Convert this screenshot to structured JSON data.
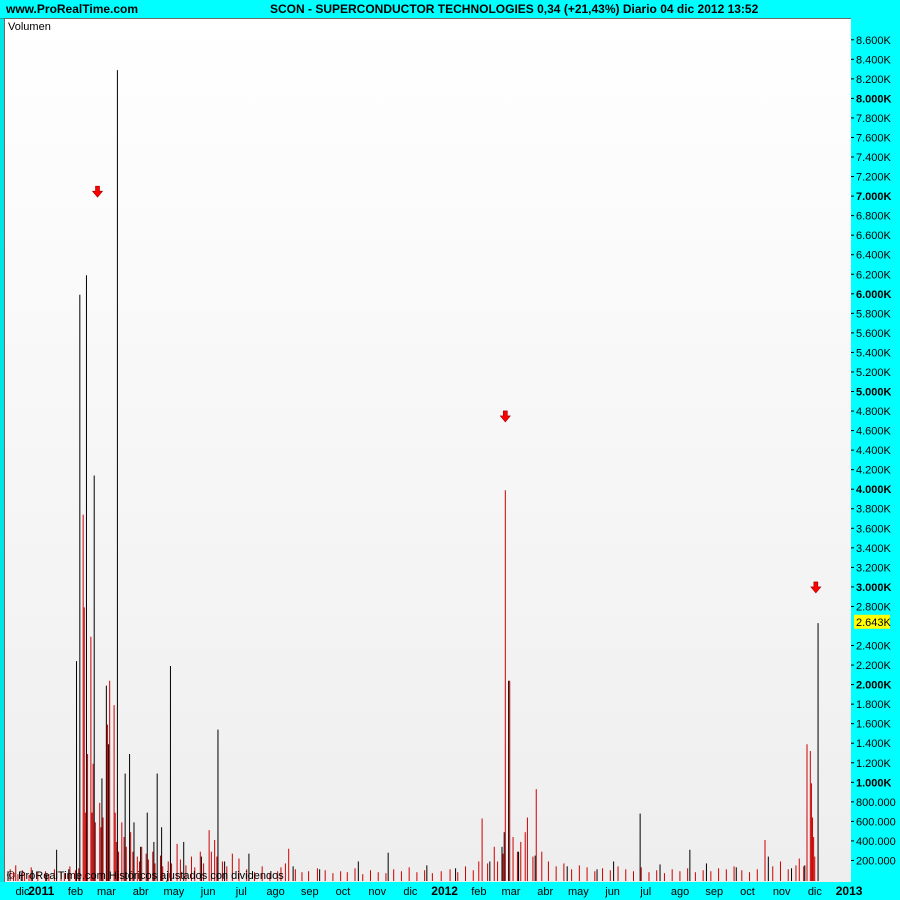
{
  "header": {
    "site": "www.ProRealTime.com",
    "title": "SCON - SUPERCONDUCTOR TECHNOLOGIES    0,34 (+21,43%)   Diario  04 dic 2012 13:52"
  },
  "plot": {
    "label": "Volumen",
    "footnote": "© ProRealTime.com  Históricos ajustados con dividendos"
  },
  "colors": {
    "up_bar": "#000000",
    "down_bar": "#cc0000",
    "marker": "#ff0000",
    "last_value_bg": "#ffff00",
    "axis_bg": "#00ffff"
  },
  "chart_data": {
    "type": "bar",
    "title": "SCON - SUPERCONDUCTOR TECHNOLOGIES",
    "indicator": "Volumen",
    "last_value_label": "2.643K",
    "last_value": 2643000,
    "ylim": [
      0,
      8700000
    ],
    "y_ticks": [
      {
        "v": 200000,
        "label": "200.000",
        "bold": false
      },
      {
        "v": 400000,
        "label": "400.000",
        "bold": false
      },
      {
        "v": 600000,
        "label": "600.000",
        "bold": false
      },
      {
        "v": 800000,
        "label": "800.000",
        "bold": false
      },
      {
        "v": 1000000,
        "label": "1.000K",
        "bold": true
      },
      {
        "v": 1200000,
        "label": "1.200K",
        "bold": false
      },
      {
        "v": 1400000,
        "label": "1.400K",
        "bold": false
      },
      {
        "v": 1600000,
        "label": "1.600K",
        "bold": false
      },
      {
        "v": 1800000,
        "label": "1.800K",
        "bold": false
      },
      {
        "v": 2000000,
        "label": "2.000K",
        "bold": true
      },
      {
        "v": 2200000,
        "label": "2.200K",
        "bold": false
      },
      {
        "v": 2400000,
        "label": "2.400K",
        "bold": false
      },
      {
        "v": 2800000,
        "label": "2.800K",
        "bold": false
      },
      {
        "v": 3000000,
        "label": "3.000K",
        "bold": true
      },
      {
        "v": 3200000,
        "label": "3.200K",
        "bold": false
      },
      {
        "v": 3400000,
        "label": "3.400K",
        "bold": false
      },
      {
        "v": 3600000,
        "label": "3.600K",
        "bold": false
      },
      {
        "v": 3800000,
        "label": "3.800K",
        "bold": false
      },
      {
        "v": 4000000,
        "label": "4.000K",
        "bold": true
      },
      {
        "v": 4200000,
        "label": "4.200K",
        "bold": false
      },
      {
        "v": 4400000,
        "label": "4.400K",
        "bold": false
      },
      {
        "v": 4600000,
        "label": "4.600K",
        "bold": false
      },
      {
        "v": 4800000,
        "label": "4.800K",
        "bold": false
      },
      {
        "v": 5000000,
        "label": "5.000K",
        "bold": true
      },
      {
        "v": 5200000,
        "label": "5.200K",
        "bold": false
      },
      {
        "v": 5400000,
        "label": "5.400K",
        "bold": false
      },
      {
        "v": 5600000,
        "label": "5.600K",
        "bold": false
      },
      {
        "v": 5800000,
        "label": "5.800K",
        "bold": false
      },
      {
        "v": 6000000,
        "label": "6.000K",
        "bold": true
      },
      {
        "v": 6200000,
        "label": "6.200K",
        "bold": false
      },
      {
        "v": 6400000,
        "label": "6.400K",
        "bold": false
      },
      {
        "v": 6600000,
        "label": "6.600K",
        "bold": false
      },
      {
        "v": 6800000,
        "label": "6.800K",
        "bold": false
      },
      {
        "v": 7000000,
        "label": "7.000K",
        "bold": true
      },
      {
        "v": 7200000,
        "label": "7.200K",
        "bold": false
      },
      {
        "v": 7400000,
        "label": "7.400K",
        "bold": false
      },
      {
        "v": 7600000,
        "label": "7.600K",
        "bold": false
      },
      {
        "v": 7800000,
        "label": "7.800K",
        "bold": false
      },
      {
        "v": 8000000,
        "label": "8.000K",
        "bold": true
      },
      {
        "v": 8200000,
        "label": "8.200K",
        "bold": false
      },
      {
        "v": 8400000,
        "label": "8.400K",
        "bold": false
      },
      {
        "v": 8600000,
        "label": "8.600K",
        "bold": false
      }
    ],
    "xlim": [
      "2010-12-01",
      "2012-12-31"
    ],
    "x_ticks": [
      {
        "date": "2010-12-15",
        "label": "dic",
        "bold": false
      },
      {
        "date": "2011-01-01",
        "label": "2011",
        "bold": true
      },
      {
        "date": "2011-02-01",
        "label": "feb",
        "bold": false
      },
      {
        "date": "2011-03-01",
        "label": "mar",
        "bold": false
      },
      {
        "date": "2011-04-01",
        "label": "abr",
        "bold": false
      },
      {
        "date": "2011-05-01",
        "label": "may",
        "bold": false
      },
      {
        "date": "2011-06-01",
        "label": "jun",
        "bold": false
      },
      {
        "date": "2011-07-01",
        "label": "jul",
        "bold": false
      },
      {
        "date": "2011-08-01",
        "label": "ago",
        "bold": false
      },
      {
        "date": "2011-09-01",
        "label": "sep",
        "bold": false
      },
      {
        "date": "2011-10-01",
        "label": "oct",
        "bold": false
      },
      {
        "date": "2011-11-01",
        "label": "nov",
        "bold": false
      },
      {
        "date": "2011-12-01",
        "label": "dic",
        "bold": false
      },
      {
        "date": "2012-01-01",
        "label": "2012",
        "bold": true
      },
      {
        "date": "2012-02-01",
        "label": "feb",
        "bold": false
      },
      {
        "date": "2012-03-01",
        "label": "mar",
        "bold": false
      },
      {
        "date": "2012-04-01",
        "label": "abr",
        "bold": false
      },
      {
        "date": "2012-05-01",
        "label": "may",
        "bold": false
      },
      {
        "date": "2012-06-01",
        "label": "jun",
        "bold": false
      },
      {
        "date": "2012-07-01",
        "label": "jul",
        "bold": false
      },
      {
        "date": "2012-08-01",
        "label": "ago",
        "bold": false
      },
      {
        "date": "2012-09-01",
        "label": "sep",
        "bold": false
      },
      {
        "date": "2012-10-01",
        "label": "oct",
        "bold": false
      },
      {
        "date": "2012-11-01",
        "label": "nov",
        "bold": false
      },
      {
        "date": "2012-12-01",
        "label": "dic",
        "bold": false
      },
      {
        "date": "2013-01-01",
        "label": "2013",
        "bold": true
      }
    ],
    "markers": [
      {
        "date": "2011-02-20",
        "v": 7050000
      },
      {
        "date": "2012-02-24",
        "v": 4750000
      },
      {
        "date": "2012-12-01",
        "v": 3000000
      }
    ],
    "series": [
      {
        "color": "down",
        "x": [
          "2010-12-03",
          "2010-12-06",
          "2010-12-08",
          "2010-12-10",
          "2010-12-14",
          "2010-12-16",
          "2010-12-20",
          "2010-12-22",
          "2010-12-28",
          "2011-01-04",
          "2011-01-07",
          "2011-01-12",
          "2011-01-18",
          "2011-01-21",
          "2011-01-26",
          "2011-01-31",
          "2011-02-03",
          "2011-02-07",
          "2011-02-08",
          "2011-02-09",
          "2011-02-11",
          "2011-02-14",
          "2011-02-15",
          "2011-02-16",
          "2011-02-18",
          "2011-02-22",
          "2011-02-23",
          "2011-02-25",
          "2011-03-01",
          "2011-03-03",
          "2011-03-07",
          "2011-03-08",
          "2011-03-09",
          "2011-03-11",
          "2011-03-14",
          "2011-03-16",
          "2011-03-18",
          "2011-03-22",
          "2011-03-24",
          "2011-03-28",
          "2011-03-30",
          "2011-04-01",
          "2011-04-05",
          "2011-04-07",
          "2011-04-11",
          "2011-04-13",
          "2011-04-18",
          "2011-04-20",
          "2011-04-25",
          "2011-04-28",
          "2011-05-03",
          "2011-05-06",
          "2011-05-11",
          "2011-05-16",
          "2011-05-19",
          "2011-05-24",
          "2011-05-27",
          "2011-06-01",
          "2011-06-03",
          "2011-06-06",
          "2011-06-08",
          "2011-06-13",
          "2011-06-17",
          "2011-06-22",
          "2011-06-28",
          "2011-07-05",
          "2011-07-12",
          "2011-07-19",
          "2011-07-26",
          "2011-08-02",
          "2011-08-05",
          "2011-08-09",
          "2011-08-12",
          "2011-08-18",
          "2011-08-24",
          "2011-08-30",
          "2011-09-07",
          "2011-09-14",
          "2011-09-21",
          "2011-09-28",
          "2011-10-04",
          "2011-10-11",
          "2011-10-18",
          "2011-10-25",
          "2011-11-01",
          "2011-11-08",
          "2011-11-15",
          "2011-11-22",
          "2011-11-29",
          "2011-12-06",
          "2011-12-13",
          "2011-12-20",
          "2011-12-28",
          "2012-01-05",
          "2012-01-12",
          "2012-01-19",
          "2012-01-26",
          "2012-01-31",
          "2012-02-03",
          "2012-02-08",
          "2012-02-14",
          "2012-02-17",
          "2012-02-22",
          "2012-02-24",
          "2012-02-28",
          "2012-03-02",
          "2012-03-06",
          "2012-03-09",
          "2012-03-13",
          "2012-03-15",
          "2012-03-20",
          "2012-03-23",
          "2012-03-28",
          "2012-04-03",
          "2012-04-10",
          "2012-04-17",
          "2012-04-24",
          "2012-05-01",
          "2012-05-08",
          "2012-05-15",
          "2012-05-22",
          "2012-05-29",
          "2012-06-05",
          "2012-06-12",
          "2012-06-19",
          "2012-06-26",
          "2012-07-03",
          "2012-07-10",
          "2012-07-17",
          "2012-07-24",
          "2012-07-31",
          "2012-08-07",
          "2012-08-14",
          "2012-08-21",
          "2012-08-28",
          "2012-09-04",
          "2012-09-11",
          "2012-09-18",
          "2012-09-25",
          "2012-10-02",
          "2012-10-09",
          "2012-10-16",
          "2012-10-23",
          "2012-10-30",
          "2012-11-06",
          "2012-11-13",
          "2012-11-16",
          "2012-11-20",
          "2012-11-23",
          "2012-11-26",
          "2012-11-27",
          "2012-11-28",
          "2012-11-29",
          "2012-11-30"
        ],
        "values": [
          120000,
          90000,
          160000,
          70000,
          110000,
          80000,
          60000,
          140000,
          90000,
          100000,
          70000,
          120000,
          90000,
          80000,
          150000,
          110000,
          130000,
          3750000,
          2800000,
          700000,
          1300000,
          2500000,
          700000,
          1200000,
          600000,
          800000,
          550000,
          650000,
          1600000,
          2050000,
          1800000,
          700000,
          400000,
          300000,
          600000,
          450000,
          350000,
          500000,
          300000,
          250000,
          200000,
          350000,
          280000,
          220000,
          300000,
          180000,
          260000,
          150000,
          200000,
          180000,
          380000,
          220000,
          160000,
          250000,
          140000,
          300000,
          180000,
          520000,
          300000,
          420000,
          250000,
          200000,
          150000,
          280000,
          230000,
          120000,
          90000,
          150000,
          80000,
          100000,
          140000,
          180000,
          330000,
          120000,
          90000,
          100000,
          130000,
          110000,
          80000,
          100000,
          90000,
          130000,
          70000,
          110000,
          90000,
          80000,
          120000,
          100000,
          140000,
          90000,
          110000,
          80000,
          100000,
          120000,
          90000,
          150000,
          110000,
          200000,
          640000,
          180000,
          350000,
          200000,
          280000,
          4000000,
          2050000,
          450000,
          300000,
          400000,
          500000,
          650000,
          250000,
          940000,
          300000,
          200000,
          150000,
          180000,
          120000,
          160000,
          140000,
          100000,
          130000,
          110000,
          150000,
          120000,
          100000,
          140000,
          90000,
          110000,
          80000,
          120000,
          100000,
          130000,
          90000,
          110000,
          100000,
          130000,
          120000,
          150000,
          110000,
          90000,
          120000,
          420000,
          150000,
          200000,
          120000,
          160000,
          230000,
          150000,
          1400000,
          1330000,
          1000000,
          650000,
          450000,
          250000
        ]
      },
      {
        "color": "up",
        "x": [
          "2010-12-01",
          "2010-12-13",
          "2010-12-23",
          "2011-01-05",
          "2011-01-14",
          "2011-01-25",
          "2011-02-01",
          "2011-02-04",
          "2011-02-10",
          "2011-02-17",
          "2011-02-24",
          "2011-02-28",
          "2011-03-02",
          "2011-03-10",
          "2011-03-17",
          "2011-03-21",
          "2011-03-25",
          "2011-03-31",
          "2011-04-06",
          "2011-04-12",
          "2011-04-15",
          "2011-04-19",
          "2011-04-27",
          "2011-05-09",
          "2011-05-25",
          "2011-06-09",
          "2011-06-15",
          "2011-07-07",
          "2011-08-16",
          "2011-09-09",
          "2011-10-14",
          "2011-11-10",
          "2011-12-15",
          "2012-01-10",
          "2012-02-10",
          "2012-02-21",
          "2012-02-23",
          "2012-02-27",
          "2012-03-07",
          "2012-03-22",
          "2012-04-20",
          "2012-05-17",
          "2012-06-01",
          "2012-06-25",
          "2012-07-13",
          "2012-08-09",
          "2012-08-24",
          "2012-09-20",
          "2012-10-19",
          "2012-11-09",
          "2012-11-21",
          "2012-12-03"
        ],
        "values": [
          100000,
          80000,
          110000,
          70000,
          320000,
          120000,
          2250000,
          6000000,
          6200000,
          4150000,
          1050000,
          2000000,
          1400000,
          8300000,
          1100000,
          1300000,
          600000,
          350000,
          700000,
          400000,
          1100000,
          550000,
          2200000,
          400000,
          250000,
          1550000,
          200000,
          280000,
          150000,
          120000,
          200000,
          290000,
          160000,
          130000,
          200000,
          350000,
          500000,
          2050000,
          300000,
          260000,
          150000,
          120000,
          200000,
          690000,
          170000,
          320000,
          180000,
          140000,
          250000,
          130000,
          160000,
          2640000
        ]
      }
    ]
  }
}
